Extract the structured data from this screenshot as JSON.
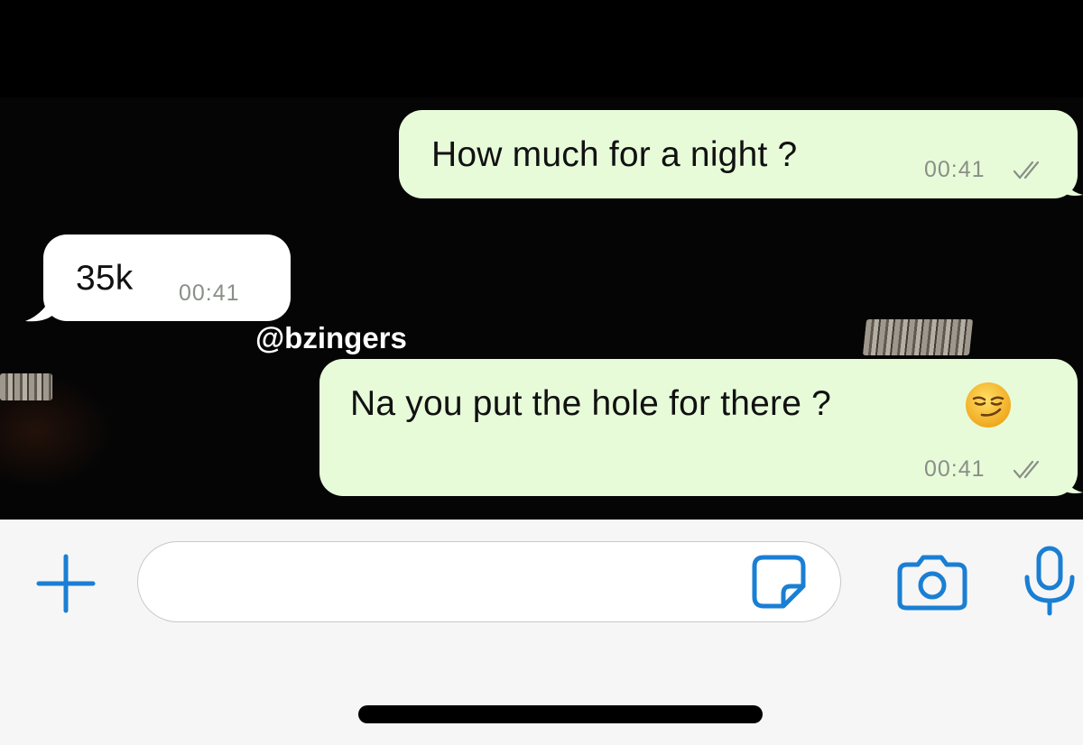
{
  "messages": [
    {
      "direction": "outgoing",
      "text": "How much for a night ?",
      "time": "00:41",
      "status": "read"
    },
    {
      "direction": "incoming",
      "text": "35k",
      "time": "00:41"
    },
    {
      "direction": "outgoing",
      "text": "Na you put the hole for there ?",
      "emoji": "smirking-face",
      "time": "00:41",
      "status": "read"
    }
  ],
  "watermark": "@bzingers",
  "composer": {
    "input_value": "",
    "icons": [
      "plus-icon",
      "sticker-icon",
      "camera-icon",
      "microphone-icon"
    ]
  },
  "colors": {
    "outgoing_bubble": "#e7fbd9",
    "incoming_bubble": "#ffffff",
    "accent": "#1a7fd4",
    "composer_bg": "#f6f6f6"
  }
}
